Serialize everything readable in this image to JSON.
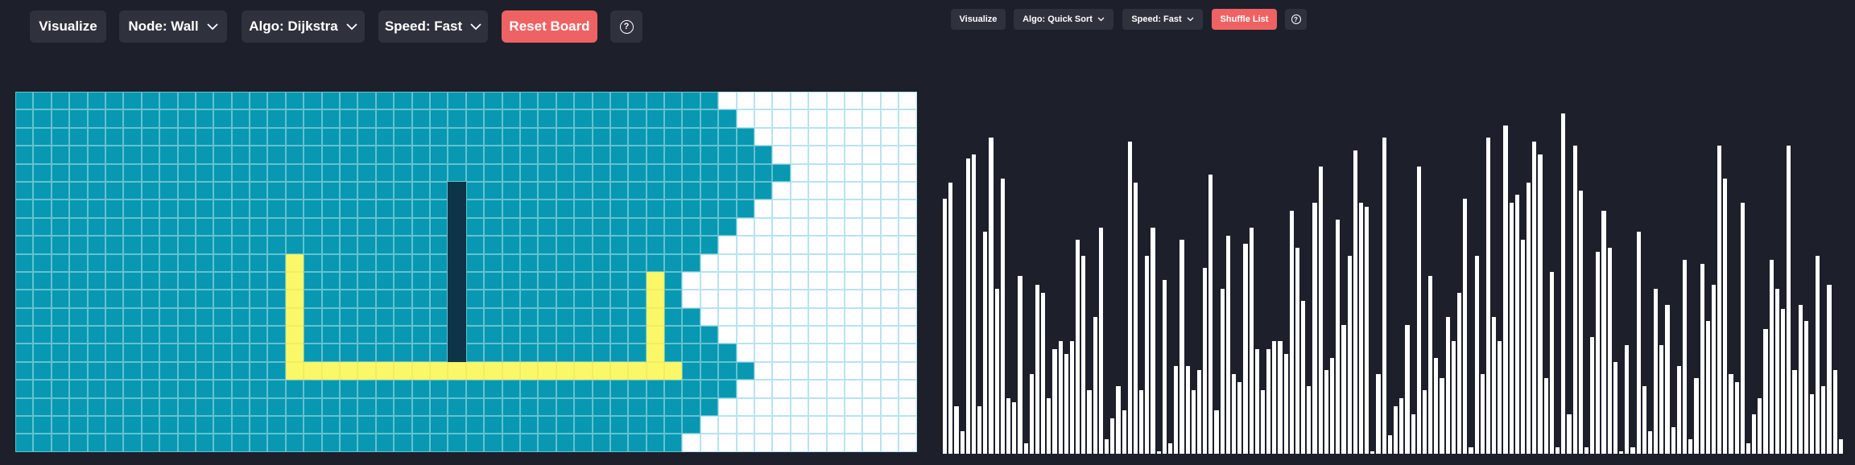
{
  "pathfinder": {
    "toolbar": {
      "visualize_label": "Visualize",
      "node_label": "Node: Wall",
      "algo_label": "Algo: Dijkstra",
      "speed_label": "Speed: Fast",
      "reset_label": "Reset Board",
      "help_glyph": "?"
    },
    "grid": {
      "rows": 20,
      "cols": 50,
      "visited_extent_by_row": [
        38,
        39,
        40,
        41,
        42,
        41,
        40,
        39,
        38,
        37,
        36,
        36,
        37,
        38,
        39,
        40,
        39,
        38,
        37,
        36
      ],
      "wall_cells": [
        [
          5,
          24
        ],
        [
          6,
          24
        ],
        [
          7,
          24
        ],
        [
          8,
          24
        ],
        [
          9,
          24
        ],
        [
          10,
          24
        ],
        [
          11,
          24
        ],
        [
          12,
          24
        ],
        [
          13,
          24
        ],
        [
          14,
          24
        ]
      ],
      "path_cells": [
        [
          9,
          15
        ],
        [
          10,
          15
        ],
        [
          11,
          15
        ],
        [
          12,
          15
        ],
        [
          13,
          15
        ],
        [
          14,
          15
        ],
        [
          15,
          15
        ],
        [
          15,
          16
        ],
        [
          15,
          17
        ],
        [
          15,
          18
        ],
        [
          15,
          19
        ],
        [
          15,
          20
        ],
        [
          15,
          21
        ],
        [
          15,
          22
        ],
        [
          15,
          23
        ],
        [
          15,
          24
        ],
        [
          15,
          25
        ],
        [
          15,
          26
        ],
        [
          15,
          27
        ],
        [
          15,
          28
        ],
        [
          15,
          29
        ],
        [
          15,
          30
        ],
        [
          15,
          31
        ],
        [
          15,
          32
        ],
        [
          15,
          33
        ],
        [
          15,
          34
        ],
        [
          15,
          35
        ],
        [
          15,
          36
        ],
        [
          10,
          35
        ],
        [
          11,
          35
        ],
        [
          12,
          35
        ],
        [
          13,
          35
        ],
        [
          14,
          35
        ]
      ],
      "colors": {
        "unvisited": "#ffffff",
        "visited": "#0898b1",
        "wall": "#0d3447",
        "path": "#faf868",
        "grid_line": "#b8e3f0"
      }
    }
  },
  "sorter": {
    "toolbar": {
      "visualize_label": "Visualize",
      "algo_label": "Algo: Quick Sort",
      "speed_label": "Speed: Fast",
      "shuffle_label": "Shuffle List",
      "help_glyph": "?"
    },
    "bar_values": [
      63,
      67,
      12,
      6,
      73,
      74,
      12,
      55,
      78,
      41,
      68,
      14,
      13,
      44,
      3,
      20,
      42,
      40,
      14,
      26,
      28,
      25,
      28,
      53,
      49,
      16,
      34,
      56,
      4,
      9,
      17,
      11,
      77,
      67,
      16,
      49,
      56,
      1,
      43,
      3,
      22,
      53,
      22,
      16,
      21,
      46,
      69,
      11,
      41,
      54,
      20,
      18,
      52,
      56,
      26,
      16,
      26,
      28,
      28,
      25,
      60,
      51,
      38,
      17,
      62,
      71,
      21,
      24,
      58,
      32,
      49,
      75,
      62,
      61,
      1,
      20,
      78,
      5,
      12,
      14,
      32,
      10,
      71,
      16,
      44,
      24,
      19,
      34,
      28,
      40,
      63,
      2,
      49,
      20,
      78,
      34,
      28,
      81,
      62,
      64,
      53,
      67,
      77,
      74,
      19,
      45,
      2,
      84,
      10,
      76,
      65,
      2,
      29,
      50,
      60,
      51,
      23,
      1,
      27,
      2,
      55,
      17,
      6,
      41,
      27,
      37,
      7,
      22,
      48,
      4,
      19,
      47,
      33,
      42,
      76,
      68,
      20,
      18,
      62,
      3,
      10,
      14,
      31,
      48,
      41,
      36,
      76,
      21,
      37,
      33,
      15,
      49,
      17,
      42,
      21,
      4
    ]
  }
}
